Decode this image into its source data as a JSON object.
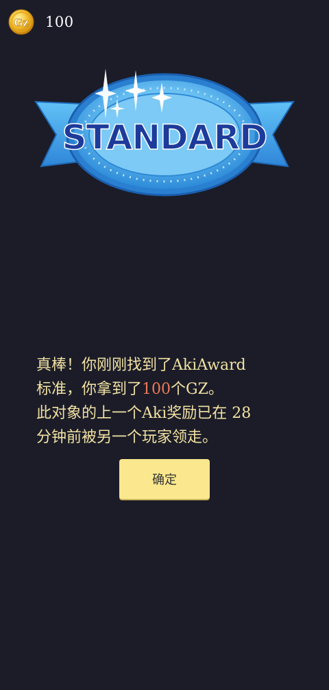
{
  "topbar": {
    "coin_icon": "gz-coin-icon",
    "coin_label": "Gz",
    "balance": "100"
  },
  "badge": {
    "text": "STANDARD",
    "icon": "standard-badge-icon",
    "colors": {
      "ribbon": "#3fa0e8",
      "medallion": "#5bb9f2",
      "text": "#1d3b9a"
    }
  },
  "message": {
    "l1a": "真棒！你刚刚找到了",
    "l1b": "AkiAward",
    "l2a": "标准，你拿到了",
    "l2_amount": "100",
    "l2b": "个",
    "l2_unit": "GZ",
    "l2c": "。",
    "l3a": "此对象的上一个",
    "l3b": "Aki",
    "l3c": "奖励已在",
    "l3_minutes": "28",
    "l4": "分钟前被另一个玩家领走。"
  },
  "confirm_button": {
    "label": "确定"
  },
  "colors": {
    "background": "#1b1c28",
    "message_text": "#f2e2a3",
    "highlight": "#ee7a58",
    "button": "#fbe88e"
  }
}
